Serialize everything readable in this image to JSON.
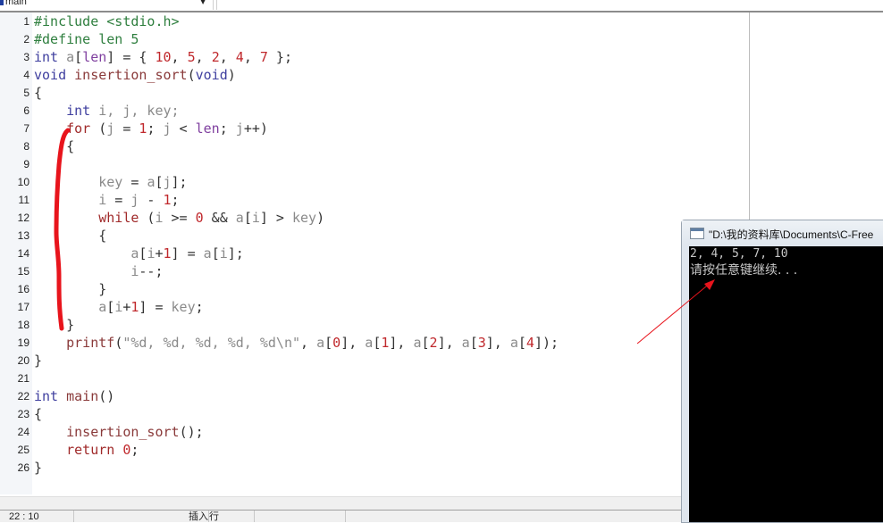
{
  "toolbar": {
    "function_combo": {
      "value": "main",
      "icon": "function-icon",
      "arrow": "▼"
    }
  },
  "editor": {
    "lines": [
      {
        "n": "1",
        "tokens": [
          [
            "pp",
            "#include <stdio.h>"
          ]
        ]
      },
      {
        "n": "2",
        "tokens": [
          [
            "pp",
            "#define len 5"
          ]
        ]
      },
      {
        "n": "3",
        "tokens": [
          [
            "kw",
            "int"
          ],
          [
            "punc",
            " "
          ],
          [
            "var",
            "a"
          ],
          [
            "punc",
            "["
          ],
          [
            "mac",
            "len"
          ],
          [
            "punc",
            "] = { "
          ],
          [
            "num",
            "10"
          ],
          [
            "punc",
            ", "
          ],
          [
            "num",
            "5"
          ],
          [
            "punc",
            ", "
          ],
          [
            "num",
            "2"
          ],
          [
            "punc",
            ", "
          ],
          [
            "num",
            "4"
          ],
          [
            "punc",
            ", "
          ],
          [
            "num",
            "7"
          ],
          [
            "punc",
            " };"
          ]
        ]
      },
      {
        "n": "4",
        "tokens": [
          [
            "kw",
            "void"
          ],
          [
            "punc",
            " "
          ],
          [
            "fn",
            "insertion_sort"
          ],
          [
            "punc",
            "("
          ],
          [
            "kw",
            "void"
          ],
          [
            "punc",
            ")"
          ]
        ]
      },
      {
        "n": "5",
        "tokens": [
          [
            "punc",
            "{"
          ]
        ]
      },
      {
        "n": "6",
        "tokens": [
          [
            "punc",
            "    "
          ],
          [
            "kw",
            "int"
          ],
          [
            "var",
            " i, j, key;"
          ]
        ]
      },
      {
        "n": "7",
        "tokens": [
          [
            "punc",
            "    "
          ],
          [
            "kw2",
            "for"
          ],
          [
            "punc",
            " ("
          ],
          [
            "var",
            "j"
          ],
          [
            "punc",
            " = "
          ],
          [
            "num",
            "1"
          ],
          [
            "punc",
            "; "
          ],
          [
            "var",
            "j"
          ],
          [
            "punc",
            " < "
          ],
          [
            "mac",
            "len"
          ],
          [
            "punc",
            "; "
          ],
          [
            "var",
            "j"
          ],
          [
            "punc",
            "++)"
          ]
        ]
      },
      {
        "n": "8",
        "tokens": [
          [
            "punc",
            "    {"
          ]
        ]
      },
      {
        "n": "9",
        "tokens": []
      },
      {
        "n": "10",
        "tokens": [
          [
            "punc",
            "        "
          ],
          [
            "var",
            "key"
          ],
          [
            "punc",
            " = "
          ],
          [
            "var",
            "a"
          ],
          [
            "punc",
            "["
          ],
          [
            "var",
            "j"
          ],
          [
            "punc",
            "];"
          ]
        ]
      },
      {
        "n": "11",
        "tokens": [
          [
            "punc",
            "        "
          ],
          [
            "var",
            "i"
          ],
          [
            "punc",
            " = "
          ],
          [
            "var",
            "j"
          ],
          [
            "punc",
            " - "
          ],
          [
            "num",
            "1"
          ],
          [
            "punc",
            ";"
          ]
        ]
      },
      {
        "n": "12",
        "tokens": [
          [
            "punc",
            "        "
          ],
          [
            "kw2",
            "while"
          ],
          [
            "punc",
            " ("
          ],
          [
            "var",
            "i"
          ],
          [
            "punc",
            " >= "
          ],
          [
            "num",
            "0"
          ],
          [
            "punc",
            " && "
          ],
          [
            "var",
            "a"
          ],
          [
            "punc",
            "["
          ],
          [
            "var",
            "i"
          ],
          [
            "punc",
            "] > "
          ],
          [
            "var",
            "key"
          ],
          [
            "punc",
            ")"
          ]
        ]
      },
      {
        "n": "13",
        "tokens": [
          [
            "punc",
            "        {"
          ]
        ]
      },
      {
        "n": "14",
        "tokens": [
          [
            "punc",
            "            "
          ],
          [
            "var",
            "a"
          ],
          [
            "punc",
            "["
          ],
          [
            "var",
            "i"
          ],
          [
            "punc",
            "+"
          ],
          [
            "num",
            "1"
          ],
          [
            "punc",
            "] = "
          ],
          [
            "var",
            "a"
          ],
          [
            "punc",
            "["
          ],
          [
            "var",
            "i"
          ],
          [
            "punc",
            "];"
          ]
        ]
      },
      {
        "n": "15",
        "tokens": [
          [
            "punc",
            "            "
          ],
          [
            "var",
            "i"
          ],
          [
            "punc",
            "--;"
          ]
        ]
      },
      {
        "n": "16",
        "tokens": [
          [
            "punc",
            "        }"
          ]
        ]
      },
      {
        "n": "17",
        "tokens": [
          [
            "punc",
            "        "
          ],
          [
            "var",
            "a"
          ],
          [
            "punc",
            "["
          ],
          [
            "var",
            "i"
          ],
          [
            "punc",
            "+"
          ],
          [
            "num",
            "1"
          ],
          [
            "punc",
            "] = "
          ],
          [
            "var",
            "key"
          ],
          [
            "punc",
            ";"
          ]
        ]
      },
      {
        "n": "18",
        "tokens": [
          [
            "punc",
            "    }"
          ]
        ]
      },
      {
        "n": "19",
        "tokens": [
          [
            "punc",
            "    "
          ],
          [
            "fn",
            "printf"
          ],
          [
            "punc",
            "("
          ],
          [
            "str",
            "\"%d, %d, %d, %d, %d\\n\""
          ],
          [
            "punc",
            ", "
          ],
          [
            "var",
            "a"
          ],
          [
            "punc",
            "["
          ],
          [
            "num",
            "0"
          ],
          [
            "punc",
            "], "
          ],
          [
            "var",
            "a"
          ],
          [
            "punc",
            "["
          ],
          [
            "num",
            "1"
          ],
          [
            "punc",
            "], "
          ],
          [
            "var",
            "a"
          ],
          [
            "punc",
            "["
          ],
          [
            "num",
            "2"
          ],
          [
            "punc",
            "], "
          ],
          [
            "var",
            "a"
          ],
          [
            "punc",
            "["
          ],
          [
            "num",
            "3"
          ],
          [
            "punc",
            "], "
          ],
          [
            "var",
            "a"
          ],
          [
            "punc",
            "["
          ],
          [
            "num",
            "4"
          ],
          [
            "punc",
            "]);"
          ]
        ]
      },
      {
        "n": "20",
        "tokens": [
          [
            "punc",
            "}"
          ]
        ]
      },
      {
        "n": "21",
        "tokens": []
      },
      {
        "n": "22",
        "tokens": [
          [
            "kw",
            "int"
          ],
          [
            "punc",
            " "
          ],
          [
            "fn",
            "main"
          ],
          [
            "punc",
            "()"
          ]
        ]
      },
      {
        "n": "23",
        "tokens": [
          [
            "punc",
            "{"
          ]
        ]
      },
      {
        "n": "24",
        "tokens": [
          [
            "punc",
            "    "
          ],
          [
            "fn",
            "insertion_sort"
          ],
          [
            "punc",
            "();"
          ]
        ]
      },
      {
        "n": "25",
        "tokens": [
          [
            "punc",
            "    "
          ],
          [
            "kw2",
            "return"
          ],
          [
            "punc",
            " "
          ],
          [
            "num",
            "0"
          ],
          [
            "punc",
            ";"
          ]
        ]
      },
      {
        "n": "26",
        "tokens": [
          [
            "punc",
            "}"
          ]
        ]
      }
    ]
  },
  "statusbar": {
    "position": "22 : 10",
    "mode": "插入",
    "line_label": "行"
  },
  "console": {
    "title": "\"D:\\我的资料库\\Documents\\C-Free",
    "icon": "console-window-icon",
    "output_lines": [
      "2, 4, 5, 7, 10",
      "请按任意键继续. . ."
    ]
  },
  "annotations": {
    "bracket_color": "#e8141c",
    "arrow_color": "#e8141c"
  }
}
